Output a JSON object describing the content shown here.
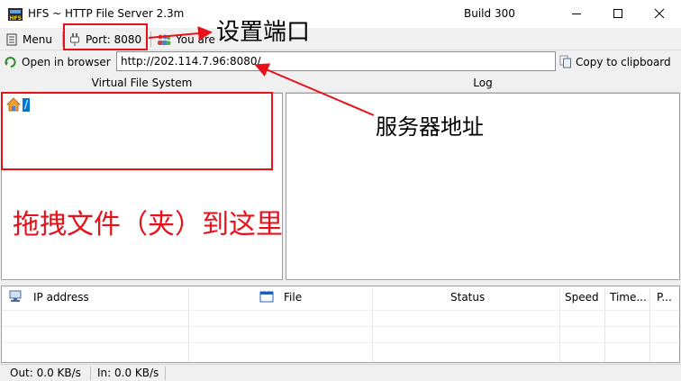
{
  "window": {
    "title": "HFS ~ HTTP File Server 2.3m",
    "build": "Build 300",
    "icon": "hfs-app-icon"
  },
  "toolbar": {
    "menu_label": "Menu",
    "port_label": "Port: 8080",
    "you_are_label": "You are"
  },
  "urlbar": {
    "open_label": "Open in browser",
    "url_value": "http://202.114.7.96:8080/",
    "copy_label": "Copy to clipboard"
  },
  "panels": {
    "vfs_title": "Virtual File System",
    "log_title": "Log",
    "vfs_root": "/"
  },
  "connections": {
    "columns": [
      "IP address",
      "File",
      "Status",
      "Speed",
      "Time...",
      "P..."
    ]
  },
  "statusbar": {
    "out": "Out: 0.0 KB/s",
    "in": "In: 0.0 KB/s"
  },
  "annotations": {
    "port_note": "设置端口",
    "address_note": "服务器地址",
    "drag_note": "拖拽文件（夹）到这里",
    "color": "#e8111a"
  }
}
